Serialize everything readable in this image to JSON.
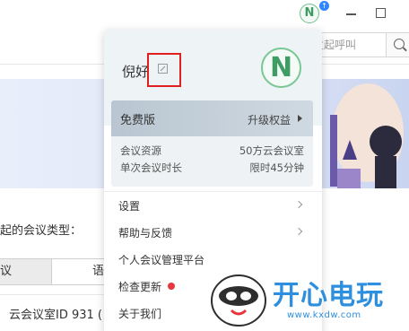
{
  "titlebar": {
    "avatar_letter": "N",
    "notification_glyph": "↑"
  },
  "topbar": {
    "call_placeholder": "发起呼叫"
  },
  "main": {
    "meeting_type_label": "起的会议类型：",
    "segments": [
      "议",
      "语"
    ],
    "room_line": "云会议室ID 931 ("
  },
  "popup": {
    "user_name": "倪好",
    "avatar_letter": "N",
    "plan": {
      "name": "免费版",
      "upgrade_label": "升级权益",
      "rows": [
        {
          "label": "会议资源",
          "value": "50方云会议室"
        },
        {
          "label": "单次会议时长",
          "value": "限时45分钟"
        }
      ]
    },
    "menu": [
      {
        "label": "设置",
        "has_arrow": true
      },
      {
        "label": "帮助与反馈",
        "has_arrow": true
      },
      {
        "label": "个人会议管理平台",
        "has_arrow": false
      },
      {
        "label": "检查更新",
        "has_arrow": false,
        "badge": true
      },
      {
        "label": "关于我们",
        "has_arrow": false
      }
    ]
  },
  "watermark": {
    "title": "开心电玩",
    "url": "www.kxdw.com"
  },
  "colors": {
    "accent_green": "#3f9d63",
    "highlight_red": "#e02020",
    "badge_red": "#e8363e",
    "watermark_blue": "#2e8fde"
  },
  "icons": [
    "avatar-icon",
    "notification-icon",
    "minimize-icon",
    "maximize-icon",
    "search-icon",
    "edit-icon",
    "chevron-right-icon"
  ]
}
